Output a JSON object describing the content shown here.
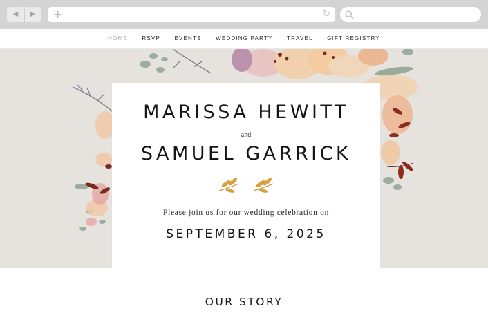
{
  "browser": {
    "back_icon": "back-arrow-icon",
    "forward_icon": "forward-arrow-icon",
    "new_tab_icon": "plus-icon",
    "reload_icon": "reload-icon",
    "search_icon": "search-icon"
  },
  "nav": {
    "items": [
      "HOME",
      "RSVP",
      "EVENTS",
      "WEDDING PARTY",
      "TRAVEL",
      "GIFT REGISTRY"
    ],
    "active_index": 0
  },
  "hero": {
    "name1": "MARISSA HEWITT",
    "and": "and",
    "name2": "SAMUEL GARRICK",
    "invite": "Please join us for our wedding celebration on",
    "date": "SEPTEMBER 6, 2025"
  },
  "sections": {
    "story_title": "OUR STORY"
  },
  "colors": {
    "hero_background": "#e6e2de",
    "leaf_accent": "#d9a441",
    "text_dark": "#151515"
  }
}
